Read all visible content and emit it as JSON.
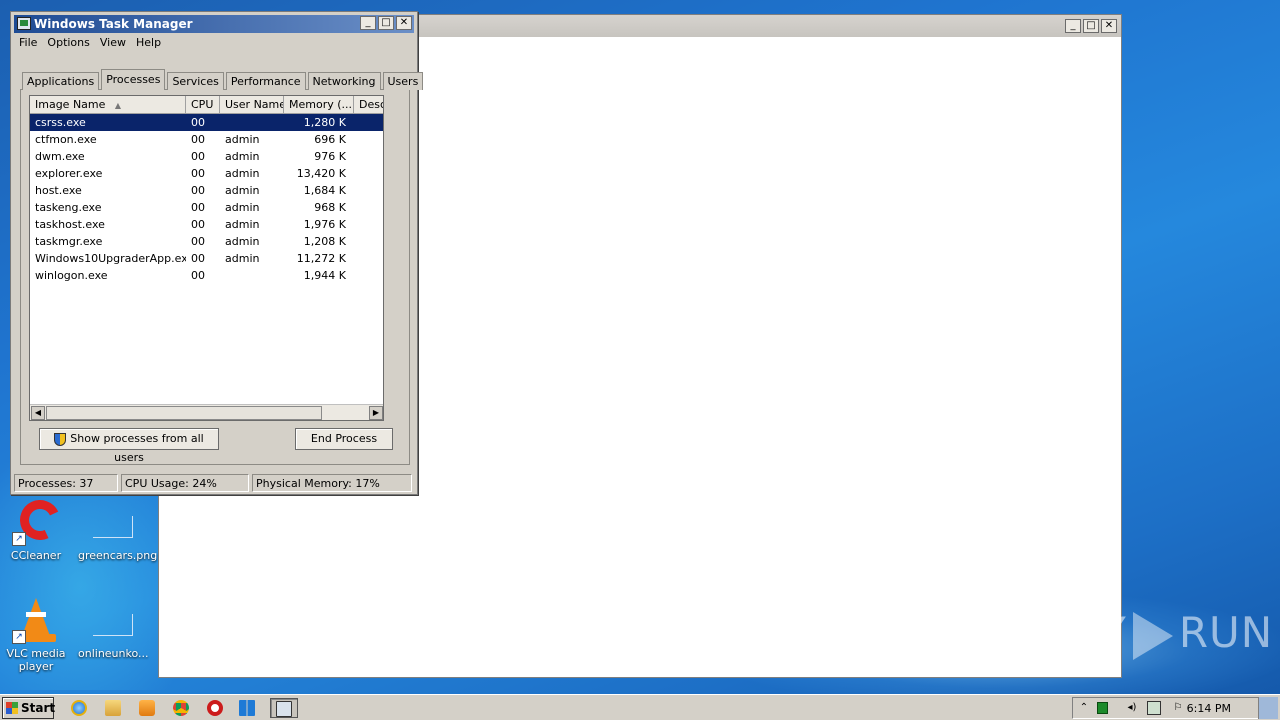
{
  "task_manager": {
    "title": "Windows Task Manager",
    "menu": [
      "File",
      "Options",
      "View",
      "Help"
    ],
    "tabs": [
      "Applications",
      "Processes",
      "Services",
      "Performance",
      "Networking",
      "Users"
    ],
    "active_tab": "Processes",
    "columns": [
      "Image Name",
      "CPU",
      "User Name",
      "Memory (...",
      "Desc"
    ],
    "sort_indicator": "▲",
    "processes": [
      {
        "name": "csrss.exe",
        "cpu": "00",
        "user": "",
        "memory": "1,280 K"
      },
      {
        "name": "ctfmon.exe",
        "cpu": "00",
        "user": "admin",
        "memory": "696 K"
      },
      {
        "name": "dwm.exe",
        "cpu": "00",
        "user": "admin",
        "memory": "976 K"
      },
      {
        "name": "explorer.exe",
        "cpu": "00",
        "user": "admin",
        "memory": "13,420 K"
      },
      {
        "name": "host.exe",
        "cpu": "00",
        "user": "admin",
        "memory": "1,684 K"
      },
      {
        "name": "taskeng.exe",
        "cpu": "00",
        "user": "admin",
        "memory": "968 K"
      },
      {
        "name": "taskhost.exe",
        "cpu": "00",
        "user": "admin",
        "memory": "1,976 K"
      },
      {
        "name": "taskmgr.exe",
        "cpu": "00",
        "user": "admin",
        "memory": "1,208 K"
      },
      {
        "name": "Windows10UpgraderApp.exe",
        "cpu": "00",
        "user": "admin",
        "memory": "11,272 K"
      },
      {
        "name": "winlogon.exe",
        "cpu": "00",
        "user": "",
        "memory": "1,944 K"
      }
    ],
    "selected_row": 0,
    "show_all_button": "Show processes from all users",
    "end_process_button": "End Process",
    "status": {
      "processes": "Processes: 37",
      "cpu": "CPU Usage: 24%",
      "memory": "Physical Memory: 17%"
    }
  },
  "window_controls": {
    "minimize": "_",
    "maximize": "□",
    "close": "✕"
  },
  "desktop_icons": [
    {
      "label": "CCleaner",
      "icon": "ccleaner-icon"
    },
    {
      "label": "greencars.png",
      "icon": "image-file-icon"
    },
    {
      "label": "VLC media player",
      "icon": "vlc-icon"
    },
    {
      "label": "onlineunko...",
      "icon": "file-icon"
    }
  ],
  "watermark": {
    "left": "ANY",
    "right": "RUN"
  },
  "taskbar": {
    "start_label": "Start",
    "clock": "6:14 PM",
    "pinned": [
      "ie-icon",
      "explorer-icon",
      "media-player-icon",
      "chrome-icon",
      "opera-icon",
      "windows-upgrade-icon",
      "task-manager-icon"
    ],
    "tray_chevron": "⌃"
  },
  "colors": {
    "selection": "#0a246a",
    "title_bar_start": "#1e4b94",
    "desktop": "#1f74cf"
  }
}
